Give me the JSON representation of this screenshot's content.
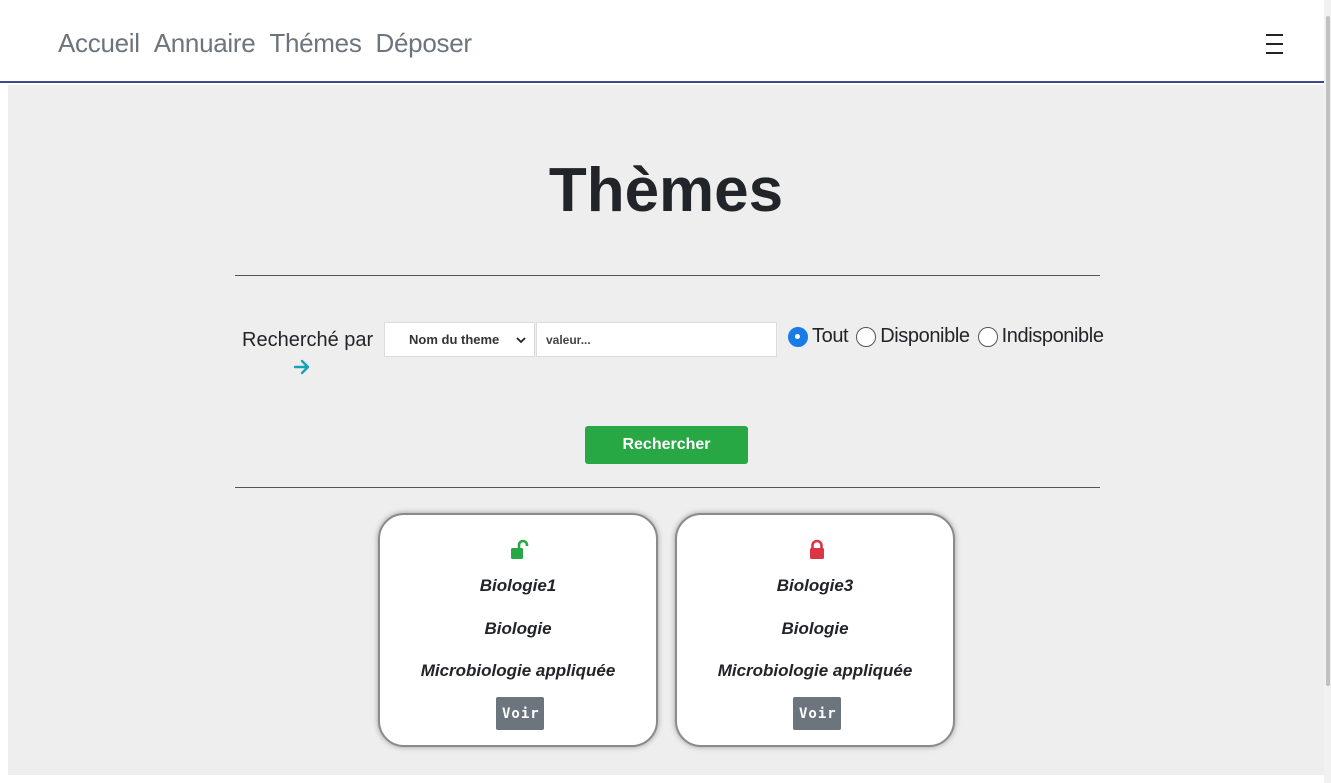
{
  "nav": {
    "links": [
      {
        "label": "Accueil"
      },
      {
        "label": "Annuaire"
      },
      {
        "label": "Thémes"
      },
      {
        "label": "Déposer"
      }
    ],
    "menu_icon": "hamburger-icon"
  },
  "page": {
    "title": "Thèmes"
  },
  "search": {
    "label": "Recherché par",
    "label_icon": "arrow-right-icon",
    "select_value": "Nom du theme",
    "input_placeholder": "valeur...",
    "radios": [
      {
        "label": "Tout",
        "checked": true
      },
      {
        "label": "Disponible",
        "checked": false
      },
      {
        "label": "Indisponible",
        "checked": false
      }
    ],
    "button_label": "Rechercher"
  },
  "cards": [
    {
      "lock_icon": "unlocked-icon",
      "lock_color": "#28a745",
      "name": "Biologie1",
      "domain": "Biologie",
      "speciality": "Microbiologie appliquée",
      "button_label": "Voir"
    },
    {
      "lock_icon": "locked-icon",
      "lock_color": "#dc3545",
      "name": "Biologie3",
      "domain": "Biologie",
      "speciality": "Microbiologie appliquée",
      "button_label": "Voir"
    }
  ],
  "colors": {
    "nav_border": "#3a4a8c",
    "background": "#eeeeee",
    "primary_green": "#28a745",
    "secondary_gray": "#6c757d",
    "radio_blue": "#1a7be6",
    "arrow_teal": "#17a2b8"
  }
}
